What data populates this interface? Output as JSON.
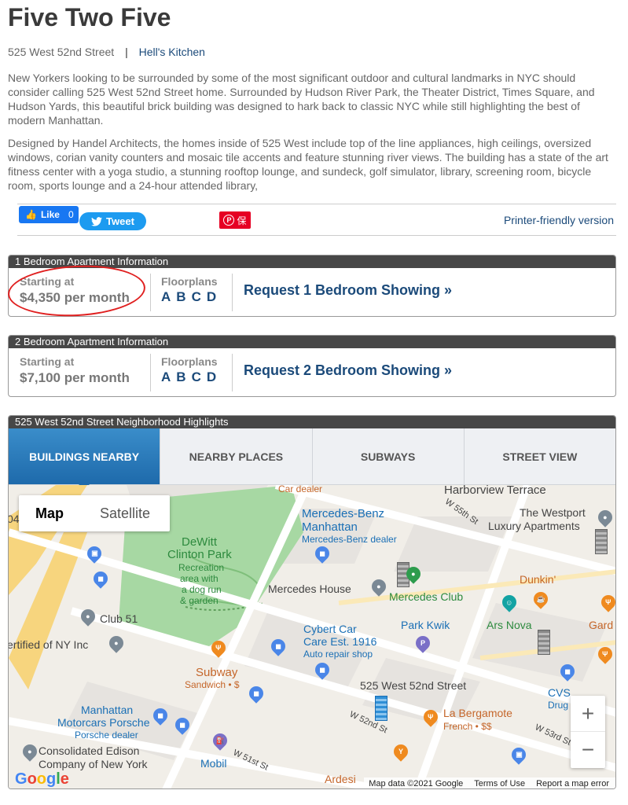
{
  "header": {
    "title": "Five Two Five",
    "address": "525 West 52nd Street",
    "separator": "|",
    "neighborhood": "Hell's Kitchen"
  },
  "description": {
    "p1": "New Yorkers looking to be surrounded by some of the most significant outdoor and cultural landmarks in NYC should consider calling 525 West 52nd Street home. Surrounded by Hudson River Park, the Theater District, Times Square, and Hudson Yards, this beautiful brick building was designed to hark back to classic NYC while still highlighting the best of modern Manhattan.",
    "p2": "Designed by Handel Architects, the homes inside of 525 West include top of the line appliances, high ceilings, oversized windows, corian vanity counters and mosaic tile accents and feature stunning river views. The building has a state of the art fitness center with a yoga studio, a stunning rooftop lounge, and sundeck, golf simulator, library, screening room, bicycle room, sports lounge and a 24-hour attended library,"
  },
  "share": {
    "like_label": "Like",
    "like_count": "0",
    "tweet_label": "Tweet",
    "pin_label": "保",
    "printer_label": "Printer-friendly version"
  },
  "apartments": [
    {
      "header": "1 Bedroom Apartment Information",
      "starting_label": "Starting at",
      "price": "$4,350 per month",
      "floorplans_label": "Floorplans",
      "floorplans": [
        "A",
        "B",
        "C",
        "D"
      ],
      "request_label": "Request 1 Bedroom Showing »"
    },
    {
      "header": "2 Bedroom Apartment Information",
      "starting_label": "Starting at",
      "price": "$7,100 per month",
      "floorplans_label": "Floorplans",
      "floorplans": [
        "A",
        "B",
        "C",
        "D"
      ],
      "request_label": "Request 2 Bedroom Showing »"
    }
  ],
  "neighborhood": {
    "header": "525 West 52nd Street Neighborhood Highlights",
    "tabs": [
      "BUILDINGS NEARBY",
      "NEARBY PLACES",
      "SUBWAYS",
      "STREET VIEW"
    ],
    "active_tab": "BUILDINGS NEARBY"
  },
  "map": {
    "toggle_map": "Map",
    "toggle_satellite": "Satellite",
    "zoom_in": "+",
    "zoom_out": "−",
    "labels": {
      "car_dealer": "Car dealer",
      "harborview": "Harborview Terrace",
      "w55": "W 55th St",
      "westport": "The Westport",
      "westport2": "Luxury Apartments",
      "benz1": "Mercedes-Benz",
      "benz2": "Manhattan",
      "benz3": "Mercedes-Benz dealer",
      "dewitt1": "DeWitt",
      "dewitt2": "Clinton Park",
      "dewitt3": "Recreation",
      "dewitt4": "area with",
      "dewitt5": "a dog run",
      "dewitt6": "& garden",
      "mercedes_house": "Mercedes House",
      "mercedes_club": "Mercedes Club",
      "dunkin": "Dunkin'",
      "club51": "Club 51",
      "park_kwik": "Park Kwik",
      "ars_nova": "Ars Nova",
      "gard": "Gard",
      "ertified": "ertified of NY Inc",
      "cybert1": "Cybert Car",
      "cybert2": "Care Est. 1916",
      "cybert3": "Auto repair shop",
      "subway": "Subway",
      "sandwich": "Sandwich • $",
      "cvs": "CVS",
      "drug": "Drug",
      "this_building": "525 West 52nd Street",
      "bergamote": "La Bergamote",
      "french": "French • $$",
      "porsche1": "Manhattan",
      "porsche2": "Motorcars Porsche",
      "porsche3": "Porsche dealer",
      "w52": "W 52nd St",
      "w53": "W 53rd St",
      "w51": "W 51st St",
      "edison1": "Consolidated Edison",
      "edison2": "Company of New York",
      "mobil": "Mobil",
      "ardesia": "Ardesi",
      "num04": "04",
      "google": "Google"
    },
    "footer": {
      "data": "Map data ©2021 Google",
      "terms": "Terms of Use",
      "report": "Report a map error"
    }
  }
}
